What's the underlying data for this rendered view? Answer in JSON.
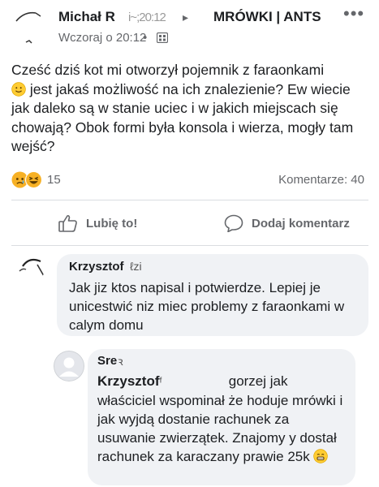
{
  "post": {
    "author_name": "Michał R",
    "author_name_scribble": "i~;20:12",
    "arrow": "▸",
    "group_name": "MRÓWKI | ANTS",
    "more": "•••",
    "timestamp": "Wczoraj o 20:12",
    "dot": "•",
    "text_before_emoji": "Cześć dziś kot mi otworzył pojemnik z faraonkami",
    "text_after_emoji": " jest jakaś możliwość na ich znalezienie? Ew wiecie jak daleko są w stanie uciec i w jakich miejscach się chowają? Obok formi była konsola i wierza, mogły tam wejść?",
    "reaction_count": "15",
    "comments_label": "Komentarze: 40"
  },
  "actions": {
    "like_label": "Lubię to!",
    "comment_label": "Dodaj komentarz"
  },
  "comments": [
    {
      "name": "Krzysztof",
      "name_scribble": "ℓzi",
      "text": "Jak jiz ktos napisal i potwierdze. Lepiej je unicestwić niz miec problemy z faraonkami w calym domu"
    },
    {
      "name": "Sre",
      "name_scribble": "ꝛ",
      "mention": "Krzysztof",
      "mention_scribble": "ᶠ",
      "text_first": "gorzej jak",
      "text_rest": "właściciel wspominał że hoduje mrówki i jak wyjdą dostanie rachunek za usuwanie zwierzątek. Znajomy y dostał rachunek za karaczany prawie 25k"
    }
  ],
  "colors": {
    "text": "#1c1e21",
    "secondary": "#65676b",
    "bubble": "#f0f2f5",
    "divider": "#dadde1"
  }
}
